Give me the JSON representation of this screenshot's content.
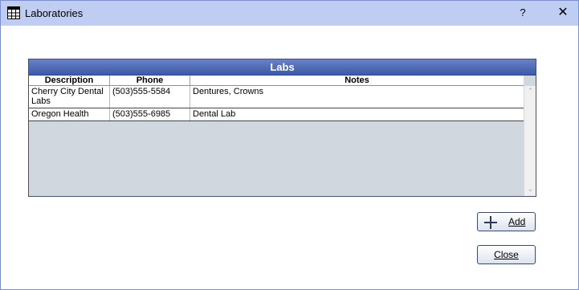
{
  "window": {
    "title": "Laboratories",
    "help_label": "?",
    "close_label": "✕"
  },
  "grid": {
    "title": "Labs",
    "columns": [
      "Description",
      "Phone",
      "Notes"
    ],
    "rows": [
      {
        "description": "Cherry City Dental Labs",
        "phone": "(503)555-5584",
        "notes": "Dentures, Crowns"
      },
      {
        "description": "Oregon Health",
        "phone": "(503)555-6985",
        "notes": "Dental Lab"
      }
    ],
    "scroll_up": "⌃",
    "scroll_down": "⌄"
  },
  "buttons": {
    "add_label": "Add",
    "close_label": "Close"
  }
}
